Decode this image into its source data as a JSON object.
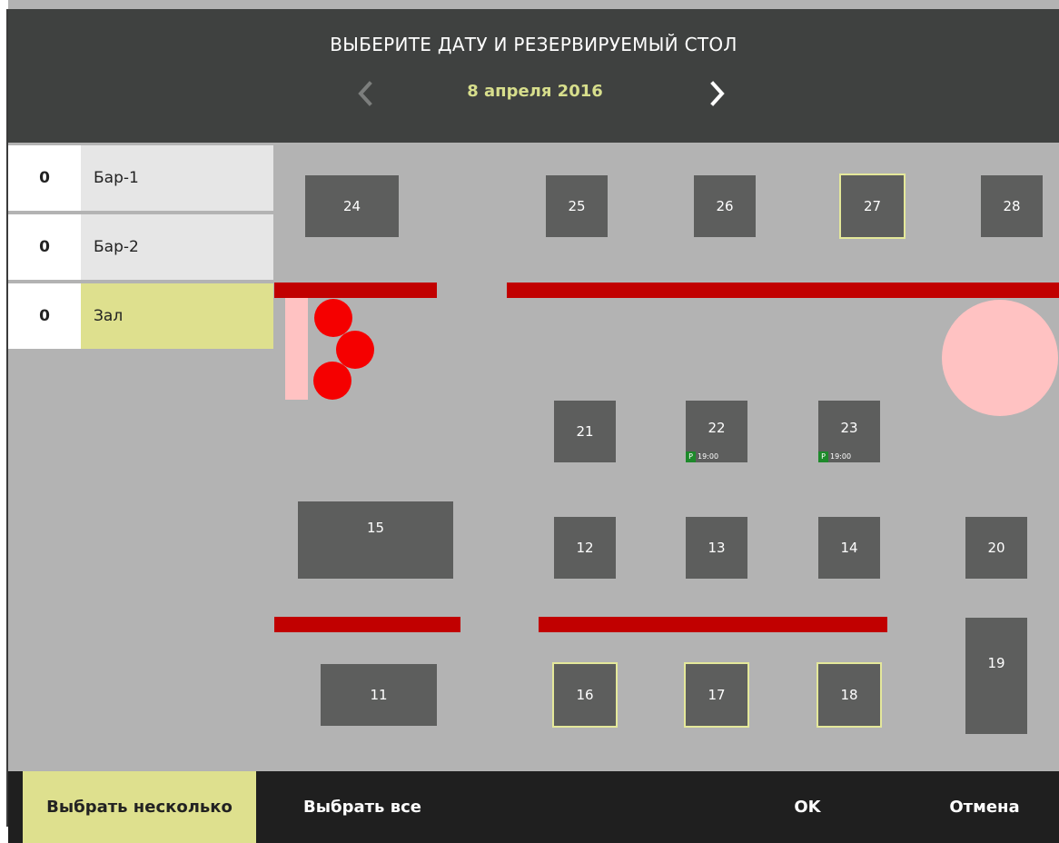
{
  "header": {
    "title": "ВЫБЕРИТЕ ДАТУ И РЕЗЕРВИРУЕМЫЙ СТОЛ",
    "date": "8 апреля 2016",
    "prev_icon": "chevron-left-icon",
    "next_icon": "chevron-right-icon"
  },
  "zones": [
    {
      "count": "0",
      "name": "Бар-1",
      "active": false
    },
    {
      "count": "0",
      "name": "Бар-2",
      "active": false
    },
    {
      "count": "0",
      "name": "Зал",
      "active": true
    }
  ],
  "tables": [
    {
      "id": "24",
      "selected": false
    },
    {
      "id": "25",
      "selected": false
    },
    {
      "id": "26",
      "selected": false
    },
    {
      "id": "27",
      "selected": true
    },
    {
      "id": "28",
      "selected": false
    },
    {
      "id": "21",
      "selected": false
    },
    {
      "id": "22",
      "selected": false,
      "reservation": {
        "mark": "Р",
        "time": "19:00"
      }
    },
    {
      "id": "23",
      "selected": false,
      "reservation": {
        "mark": "Р",
        "time": "19:00"
      }
    },
    {
      "id": "15",
      "selected": false
    },
    {
      "id": "12",
      "selected": false
    },
    {
      "id": "13",
      "selected": false
    },
    {
      "id": "14",
      "selected": false
    },
    {
      "id": "20",
      "selected": false
    },
    {
      "id": "11",
      "selected": false
    },
    {
      "id": "16",
      "selected": true
    },
    {
      "id": "17",
      "selected": true
    },
    {
      "id": "18",
      "selected": true
    },
    {
      "id": "19",
      "selected": false
    }
  ],
  "footer": {
    "select_multiple": "Выбрать несколько",
    "select_all": "Выбрать все",
    "ok": "OK",
    "cancel": "Отмена"
  },
  "colors": {
    "header_bg": "#3f4140",
    "accent": "#dee08e",
    "date_text": "#d7de8c",
    "floor": "#b3b3b3",
    "table": "#5d5e5d",
    "wall": "#c10000",
    "seat": "#f50000",
    "decor": "#ffc2c2",
    "reserved_badge": "#1e8a2b",
    "footer_bg": "#1f1f1f"
  }
}
